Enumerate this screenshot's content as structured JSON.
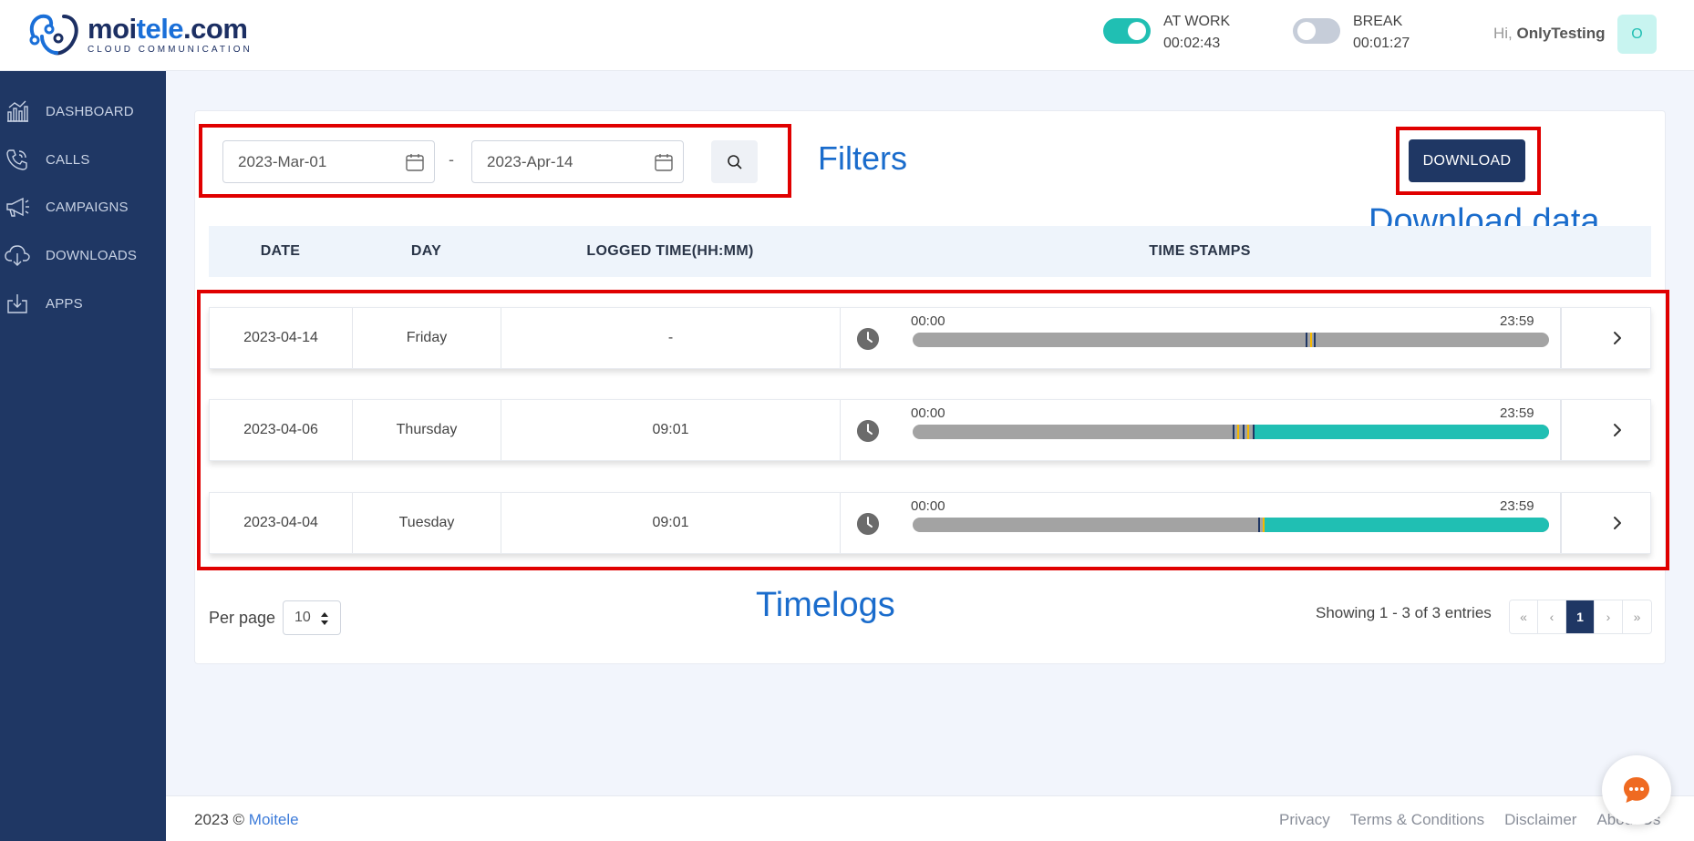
{
  "header": {
    "brand_main": "moi",
    "brand_accent": "tele",
    "brand_suffix": ".com",
    "brand_tagline": "CLOUD COMMUNICATION",
    "at_work": {
      "label": "AT WORK",
      "time": "00:02:43",
      "on": true
    },
    "break": {
      "label": "BREAK",
      "time": "00:01:27",
      "on": false
    },
    "greeting_prefix": "Hi, ",
    "user_name": "OnlyTesting",
    "avatar_initial": "O"
  },
  "sidebar": {
    "items": [
      {
        "label": "DASHBOARD",
        "icon": "dashboard-icon"
      },
      {
        "label": "CALLS",
        "icon": "phone-icon"
      },
      {
        "label": "CAMPAIGNS",
        "icon": "megaphone-icon"
      },
      {
        "label": "DOWNLOADS",
        "icon": "cloud-download-icon"
      },
      {
        "label": "APPS",
        "icon": "apps-icon"
      }
    ]
  },
  "filters": {
    "from_date": "2023-Mar-01",
    "to_date": "2023-Apr-14",
    "separator": "-"
  },
  "download_label": "DOWNLOAD",
  "annotations": {
    "filters": "Filters",
    "download": "Download data",
    "timelogs": "Timelogs"
  },
  "table": {
    "headers": [
      "DATE",
      "DAY",
      "LOGGED TIME(HH:MM)",
      "TIME STAMPS"
    ],
    "timeline_start": "00:00",
    "timeline_end": "23:59",
    "rows": [
      {
        "date": "2023-04-14",
        "day": "Friday",
        "logged": "-",
        "fill_from": 0,
        "fill_to": 0,
        "marks": [
          0.618,
          0.624,
          0.63
        ]
      },
      {
        "date": "2023-04-06",
        "day": "Thursday",
        "logged": "09:01",
        "fill_from": 0.535,
        "fill_to": 1.0,
        "marks": [
          0.503,
          0.51,
          0.518,
          0.526,
          0.534
        ]
      },
      {
        "date": "2023-04-04",
        "day": "Tuesday",
        "logged": "09:01",
        "fill_from": 0.553,
        "fill_to": 1.0,
        "marks": [
          0.543,
          0.55
        ]
      }
    ]
  },
  "pagination": {
    "per_page_label": "Per page",
    "per_page_value": "10",
    "showing": "Showing 1 - 3 of 3 entries",
    "first": "«",
    "prev": "‹",
    "current": "1",
    "next": "›",
    "last": "»"
  },
  "footer": {
    "copyright_prefix": "2023 © ",
    "company": "Moitele",
    "links": [
      "Privacy",
      "Terms & Conditions",
      "Disclaimer",
      "About Us"
    ]
  },
  "colors": {
    "brand": "#1f3764",
    "accent": "#20bfb3",
    "timeline_bg": "#a3a3a3",
    "mark_blue": "#1f3764",
    "mark_yellow": "#f5b800",
    "annotation": "#e00000"
  }
}
